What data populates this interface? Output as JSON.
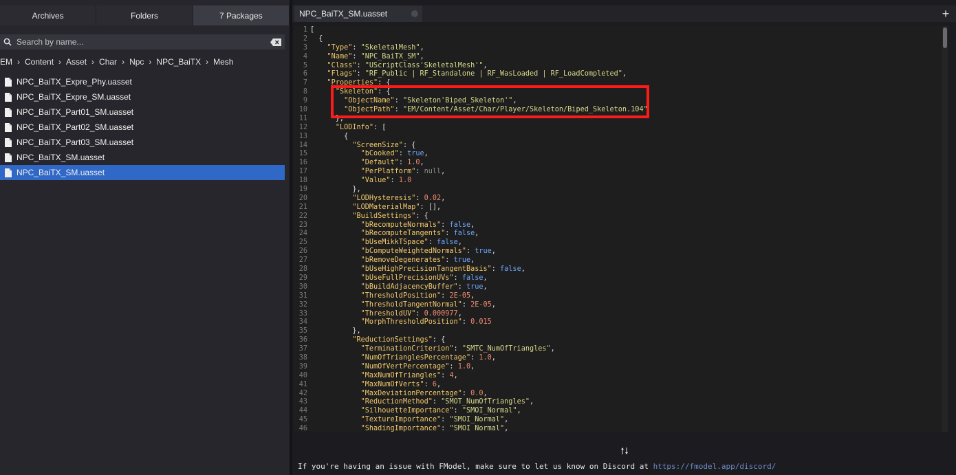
{
  "left": {
    "tabs": [
      {
        "label": "Archives"
      },
      {
        "label": "Folders"
      },
      {
        "label": "7 Packages"
      }
    ],
    "active_tab": 2,
    "search": {
      "placeholder": "Search by name...",
      "value": ""
    },
    "breadcrumb": [
      "EM",
      "Content",
      "Asset",
      "Char",
      "Npc",
      "NPC_BaiTX",
      "Mesh"
    ],
    "files": [
      {
        "name": "NPC_BaiTX_Expre_Phy.uasset"
      },
      {
        "name": "NPC_BaiTX_Expre_SM.uasset"
      },
      {
        "name": "NPC_BaiTX_Part01_SM.uasset"
      },
      {
        "name": "NPC_BaiTX_Part02_SM.uasset"
      },
      {
        "name": "NPC_BaiTX_Part03_SM.uasset"
      },
      {
        "name": "NPC_BaiTX_SM.uasset"
      },
      {
        "name": "NPC_BaiTX_SM.uasset"
      }
    ],
    "selected_file": 6
  },
  "right": {
    "document_tab": "NPC_BaiTX_SM.uasset",
    "new_tab_icon": "plus-icon",
    "code_lines": [
      "[",
      "  {",
      "    \"Type\": \"SkeletalMesh\",",
      "    \"Name\": \"NPC_BaiTX_SM\",",
      "    \"Class\": \"UScriptClass'SkeletalMesh'\",",
      "    \"Flags\": \"RF_Public | RF_Standalone | RF_WasLoaded | RF_LoadCompleted\",",
      "    \"Properties\": {",
      "      \"Skeleton\": {",
      "        \"ObjectName\": \"Skeleton'Biped_Skeleton'\",",
      "        \"ObjectPath\": \"EM/Content/Asset/Char/Player/Skeleton/Biped_Skeleton.104\"",
      "      },",
      "      \"LODInfo\": [",
      "        {",
      "          \"ScreenSize\": {",
      "            \"bCooked\": true,",
      "            \"Default\": 1.0,",
      "            \"PerPlatform\": null,",
      "            \"Value\": 1.0",
      "          },",
      "          \"LODHysteresis\": 0.02,",
      "          \"LODMaterialMap\": [],",
      "          \"BuildSettings\": {",
      "            \"bRecomputeNormals\": false,",
      "            \"bRecomputeTangents\": false,",
      "            \"bUseMikkTSpace\": false,",
      "            \"bComputeWeightedNormals\": true,",
      "            \"bRemoveDegenerates\": true,",
      "            \"bUseHighPrecisionTangentBasis\": false,",
      "            \"bUseFullPrecisionUVs\": false,",
      "            \"bBuildAdjacencyBuffer\": true,",
      "            \"ThresholdPosition\": 2E-05,",
      "            \"ThresholdTangentNormal\": 2E-05,",
      "            \"ThresholdUV\": 0.000977,",
      "            \"MorphThresholdPosition\": 0.015",
      "          },",
      "          \"ReductionSettings\": {",
      "            \"TerminationCriterion\": \"SMTC_NumOfTriangles\",",
      "            \"NumOfTrianglesPercentage\": 1.0,",
      "            \"NumOfVertPercentage\": 1.0,",
      "            \"MaxNumOfTriangles\": 4,",
      "            \"MaxNumOfVerts\": 6,",
      "            \"MaxDeviationPercentage\": 0.0,",
      "            \"ReductionMethod\": \"SMOT_NumOfTriangles\",",
      "            \"SilhouetteImportance\": \"SMOI_Normal\",",
      "            \"TextureImportance\": \"SMOI_Normal\",",
      "            \"ShadingImportance\": \"SMOI_Normal\","
    ],
    "status": {
      "text": "If you're having an issue with FModel, make sure to let us know on Discord at ",
      "link": "https://fmodel.app/discord/"
    }
  }
}
